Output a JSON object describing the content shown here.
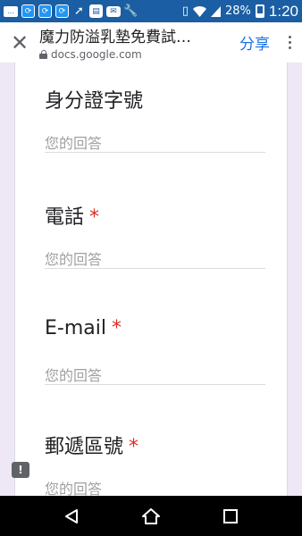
{
  "status_bar": {
    "battery_percent": "28%",
    "time": "1:20",
    "icons": [
      "message-icon",
      "sync-icon",
      "sync-icon",
      "sync-icon",
      "gesture-icon",
      "docs-icon",
      "outlook-icon",
      "wrench-icon",
      "vibrate-icon",
      "wifi-icon",
      "signal-icon",
      "battery-icon"
    ]
  },
  "app_bar": {
    "title": "魔力防溢乳墊免費試…",
    "url": "docs.google.com",
    "share_label": "分享"
  },
  "form": {
    "questions": [
      {
        "label": "身分證字號",
        "required": false,
        "placeholder": "您的回答"
      },
      {
        "label": "電話",
        "required": true,
        "placeholder": "您的回答"
      },
      {
        "label": "E-mail",
        "required": true,
        "placeholder": "您的回答"
      },
      {
        "label": "郵遞區號",
        "required": true,
        "placeholder": "您的回答"
      }
    ],
    "required_mark": "*"
  },
  "colors": {
    "status_bar": "#1b5ea3",
    "accent": "#1a73e8",
    "required": "#d93025",
    "page_background": "#ede7f6"
  }
}
